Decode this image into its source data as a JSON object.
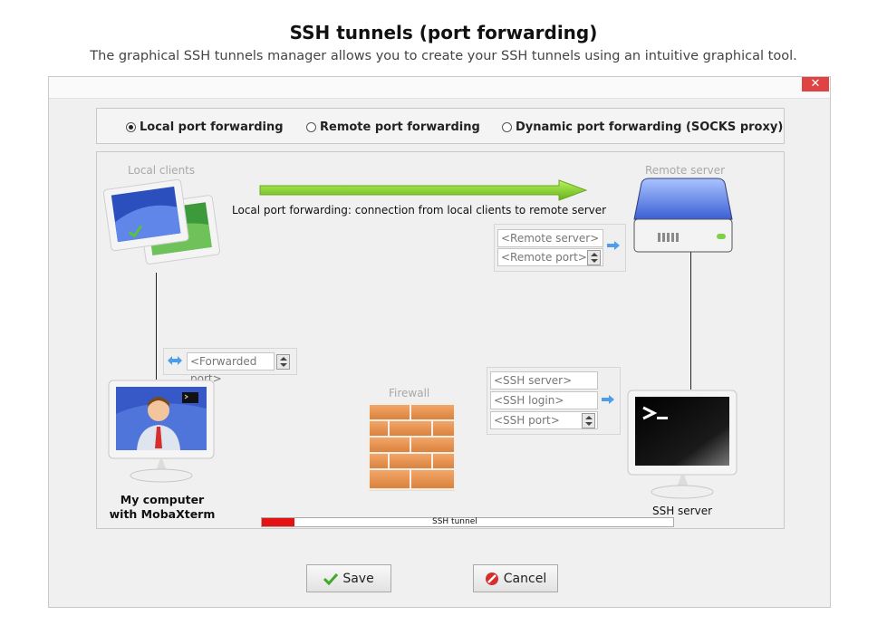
{
  "page": {
    "title": "SSH tunnels (port forwarding)",
    "subtitle": "The graphical SSH tunnels manager allows you to create your SSH tunnels using an intuitive graphical tool."
  },
  "window": {
    "close_label": "✕"
  },
  "modes": [
    {
      "label": "Local port forwarding",
      "selected": true
    },
    {
      "label": "Remote port forwarding",
      "selected": false
    },
    {
      "label": "Dynamic port forwarding (SOCKS proxy)",
      "selected": false
    }
  ],
  "diagram": {
    "local_clients_label": "Local clients",
    "remote_server_label": "Remote server",
    "arrow_description": "Local port forwarding: connection from local clients to remote server",
    "firewall_label": "Firewall",
    "tunnel_label": "SSH tunnel",
    "my_computer_line1": "My computer",
    "my_computer_line2": "with MobaXterm",
    "ssh_server_label": "SSH server"
  },
  "fields": {
    "remote_server": {
      "value": "",
      "placeholder": "<Remote server>"
    },
    "remote_port": {
      "value": "",
      "placeholder": "<Remote port>"
    },
    "forwarded_port": {
      "value": "",
      "placeholder": "<Forwarded port>"
    },
    "ssh_server": {
      "value": "",
      "placeholder": "<SSH server>"
    },
    "ssh_login": {
      "value": "",
      "placeholder": "<SSH login>"
    },
    "ssh_port": {
      "value": "",
      "placeholder": "<SSH port>"
    }
  },
  "buttons": {
    "save_label": "Save",
    "cancel_label": "Cancel"
  },
  "colors": {
    "close": "#e04343",
    "tunnel_red": "#e41212",
    "arrow_green": "#7ecb2a",
    "save_check": "#3fa92a",
    "cancel_red": "#d62d2d"
  }
}
